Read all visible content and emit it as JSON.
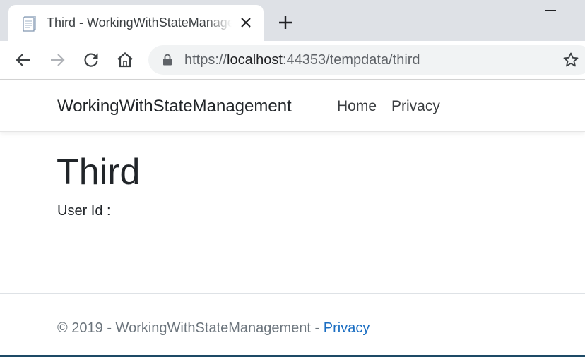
{
  "browser": {
    "tab": {
      "title": "Third - WorkingWithStateManagement",
      "favicon": "page-icon"
    },
    "address": {
      "scheme": "https://",
      "host": "localhost",
      "path": ":44353/tempdata/third"
    }
  },
  "site": {
    "brand": "WorkingWithStateManagement",
    "nav": [
      {
        "label": "Home"
      },
      {
        "label": "Privacy"
      }
    ]
  },
  "main": {
    "title": "Third",
    "user_label": "User Id :"
  },
  "footer": {
    "copyright": "© 2019 - WorkingWithStateManagement - ",
    "privacy_link": "Privacy"
  },
  "colors": {
    "tabstrip": "#dee1e6",
    "omnibox": "#f1f3f4",
    "text": "#212529",
    "footer_text": "#6c757d",
    "link": "#1b6ec2"
  }
}
